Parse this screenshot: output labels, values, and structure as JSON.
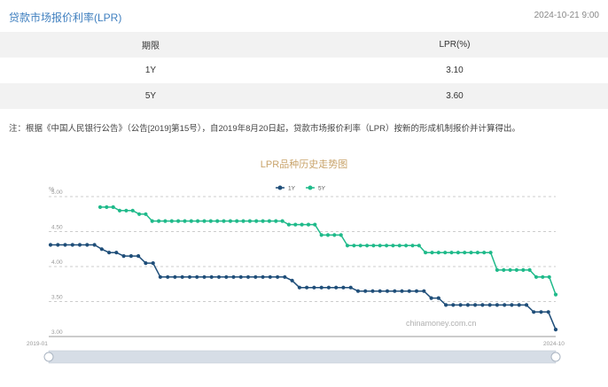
{
  "header": {
    "title": "贷款市场报价利率(LPR)",
    "timestamp": "2024-10-21 9:00"
  },
  "table": {
    "columns": [
      "期限",
      "LPR(%)"
    ],
    "rows": [
      {
        "term": "1Y",
        "rate": "3.10"
      },
      {
        "term": "5Y",
        "rate": "3.60"
      }
    ]
  },
  "note": "注：根据《中国人民银行公告》（公告[2019]第15号），自2019年8月20日起，贷款市场报价利率（LPR）按新的形成机制报价并计算得出。",
  "chart_data": {
    "type": "line",
    "title": "LPR品种历史走势图",
    "ylabel": "%",
    "ylim": [
      3.0,
      5.0
    ],
    "grid": true,
    "legend_position": "top-center",
    "y_ticks": [
      "5.00",
      "4.50",
      "4.00",
      "3.50",
      "3.00"
    ],
    "x_ticks": [
      "2019-01",
      "2024-10"
    ],
    "watermark": "chinamoney.com.cn",
    "series": [
      {
        "name": "1Y",
        "color": "#1f4e79",
        "values": [
          4.31,
          4.31,
          4.31,
          4.31,
          4.31,
          4.31,
          4.31,
          4.25,
          4.2,
          4.2,
          4.15,
          4.15,
          4.15,
          4.05,
          4.05,
          3.85,
          3.85,
          3.85,
          3.85,
          3.85,
          3.85,
          3.85,
          3.85,
          3.85,
          3.85,
          3.85,
          3.85,
          3.85,
          3.85,
          3.85,
          3.85,
          3.85,
          3.85,
          3.8,
          3.7,
          3.7,
          3.7,
          3.7,
          3.7,
          3.7,
          3.7,
          3.7,
          3.65,
          3.65,
          3.65,
          3.65,
          3.65,
          3.65,
          3.65,
          3.65,
          3.65,
          3.65,
          3.55,
          3.55,
          3.45,
          3.45,
          3.45,
          3.45,
          3.45,
          3.45,
          3.45,
          3.45,
          3.45,
          3.45,
          3.45,
          3.45,
          3.35,
          3.35,
          3.35,
          3.1
        ]
      },
      {
        "name": "5Y",
        "color": "#1fba8a",
        "values": [
          4.85,
          4.85,
          4.85,
          4.8,
          4.8,
          4.8,
          4.75,
          4.75,
          4.65,
          4.65,
          4.65,
          4.65,
          4.65,
          4.65,
          4.65,
          4.65,
          4.65,
          4.65,
          4.65,
          4.65,
          4.65,
          4.65,
          4.65,
          4.65,
          4.65,
          4.65,
          4.65,
          4.65,
          4.65,
          4.6,
          4.6,
          4.6,
          4.6,
          4.6,
          4.45,
          4.45,
          4.45,
          4.45,
          4.3,
          4.3,
          4.3,
          4.3,
          4.3,
          4.3,
          4.3,
          4.3,
          4.3,
          4.3,
          4.3,
          4.3,
          4.2,
          4.2,
          4.2,
          4.2,
          4.2,
          4.2,
          4.2,
          4.2,
          4.2,
          4.2,
          4.2,
          3.95,
          3.95,
          3.95,
          3.95,
          3.95,
          3.95,
          3.85,
          3.85,
          3.85,
          3.6
        ]
      }
    ]
  }
}
